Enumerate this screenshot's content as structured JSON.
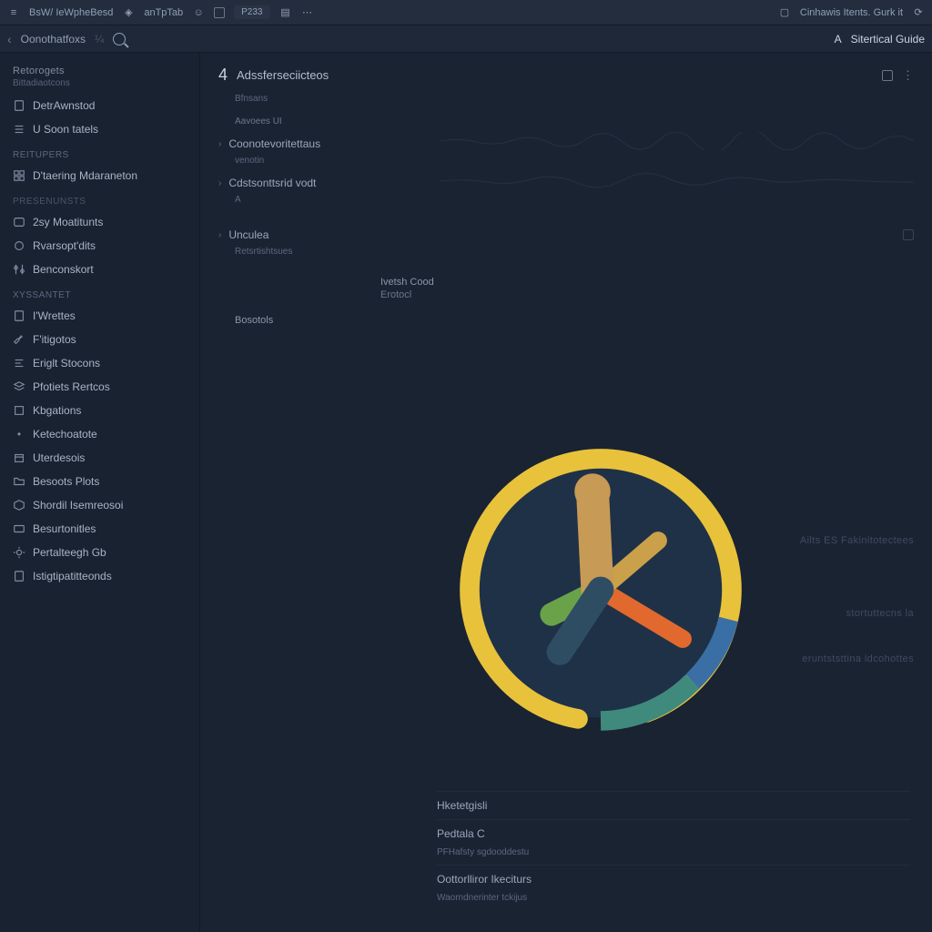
{
  "appbar": {
    "left_a": "BsW/ IeWpheBesd",
    "left_b": "anTpTab",
    "pill": "P233",
    "right": "Cinhawis Itents. Gurk it"
  },
  "toolbar": {
    "crumb": "Oonothatfoxs",
    "crumb_suffix": "¼",
    "letter": "A",
    "title": "Sitertical Guide"
  },
  "sidebar": {
    "group1_head": "Retorogets",
    "group1_sub": "Bittadiaotcons",
    "section_a": "ReitUpers",
    "section_b": "Presenunsts",
    "section_c": "Xyssantet",
    "items": [
      "DetrAwnstod",
      "U Soon tatels",
      "D'taering Mdaraneton",
      "2sy Moatitunts",
      "Rvarsopt'dits",
      "Benconskort",
      "I'Wrettes",
      "F'itigotos",
      "Eriglt Stocons",
      "Pfotiets Rertcos",
      "Kbgations",
      "Ketechoatote",
      "Uterdesois",
      "Besoots Plots",
      "Shordil Isemreosoi",
      "Besurtonitles",
      "Pertalteegh Gb",
      "Istigtipatitteonds"
    ]
  },
  "content": {
    "head_num": "4",
    "head_label": "Adssferseciicteos",
    "head_sub": "Bfnsans",
    "row_a": "Aavoees UI",
    "row_b": "Coonotevoritettaus",
    "row_b_sub": "venotin",
    "row_c": "Cdstsonttsrid vodt",
    "row_c_sub": "A",
    "row_d": "Unculea",
    "row_d_sub": "Retsrtishtsues",
    "kv_a_label": "Ivetsh Cood",
    "kv_a_value": "Erotocl",
    "teal": "Bosotols",
    "below_a": "Hketetgisli",
    "below_b": "Pedtala C",
    "below_b_sub": "PFHafsty sgdooddestu",
    "below_c": "Oottorlliror Ikeciturs",
    "below_d": "Waorndnerinter tckijus"
  },
  "ghost": {
    "g1": "Ailts   ES  Fakinitotectees",
    "g2": "stortuttecns   la",
    "g3": "eruntststtina idcohottes"
  }
}
